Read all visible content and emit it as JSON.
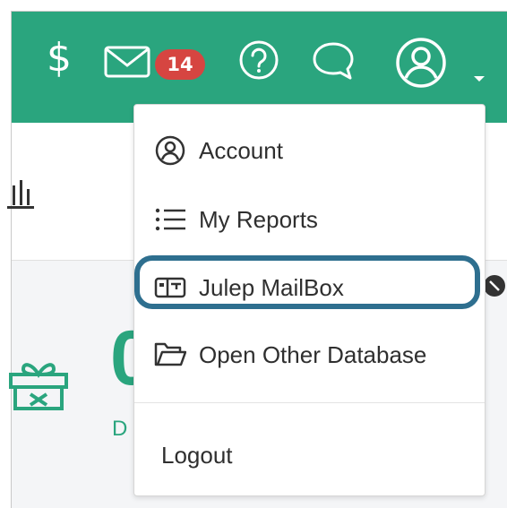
{
  "header": {
    "dollar_symbol": "$",
    "mail_badge_count": "14",
    "icons": [
      "dollar-icon",
      "mail-icon",
      "help-icon",
      "chat-icon",
      "user-icon",
      "caret-down-icon"
    ]
  },
  "content": {
    "big_number": "0",
    "small_letter": "D"
  },
  "user_menu": {
    "items": [
      {
        "label": "Account",
        "icon": "user-circle-icon"
      },
      {
        "label": "My Reports",
        "icon": "list-icon"
      },
      {
        "label": "Julep MailBox",
        "icon": "mailbox-icon",
        "highlighted": true
      },
      {
        "label": "Open Other Database",
        "icon": "folder-open-icon"
      },
      {
        "label": "Logout",
        "icon": ""
      }
    ]
  },
  "colors": {
    "brand_green": "#2aa57e",
    "badge_red": "#d64541",
    "highlight_blue": "#2e6f8f"
  }
}
